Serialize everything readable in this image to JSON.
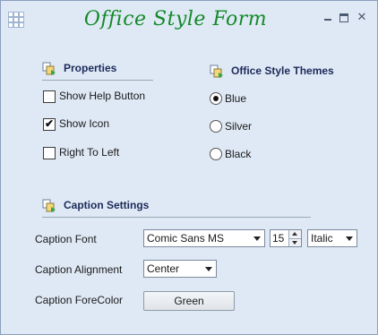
{
  "window": {
    "title": "Office Style Form",
    "title_color": "#138a2a",
    "close_glyph": "✕"
  },
  "properties": {
    "header": "Properties",
    "show_help_button": {
      "label": "Show Help Button",
      "checked": false
    },
    "show_icon": {
      "label": "Show Icon",
      "checked": true
    },
    "right_to_left": {
      "label": "Right To Left",
      "checked": false
    }
  },
  "themes": {
    "header": "Office Style Themes",
    "options": [
      {
        "label": "Blue",
        "selected": true
      },
      {
        "label": "Silver",
        "selected": false
      },
      {
        "label": "Black",
        "selected": false
      }
    ]
  },
  "caption": {
    "header": "Caption Settings",
    "font_label": "Caption Font",
    "font_value": "Comic Sans MS",
    "size_value": "15",
    "style_value": "Italic",
    "alignment_label": "Caption Alignment",
    "alignment_value": "Center",
    "forecolor_label": "Caption ForeColor",
    "forecolor_button": "Green"
  },
  "icons": {
    "check": "✔"
  }
}
